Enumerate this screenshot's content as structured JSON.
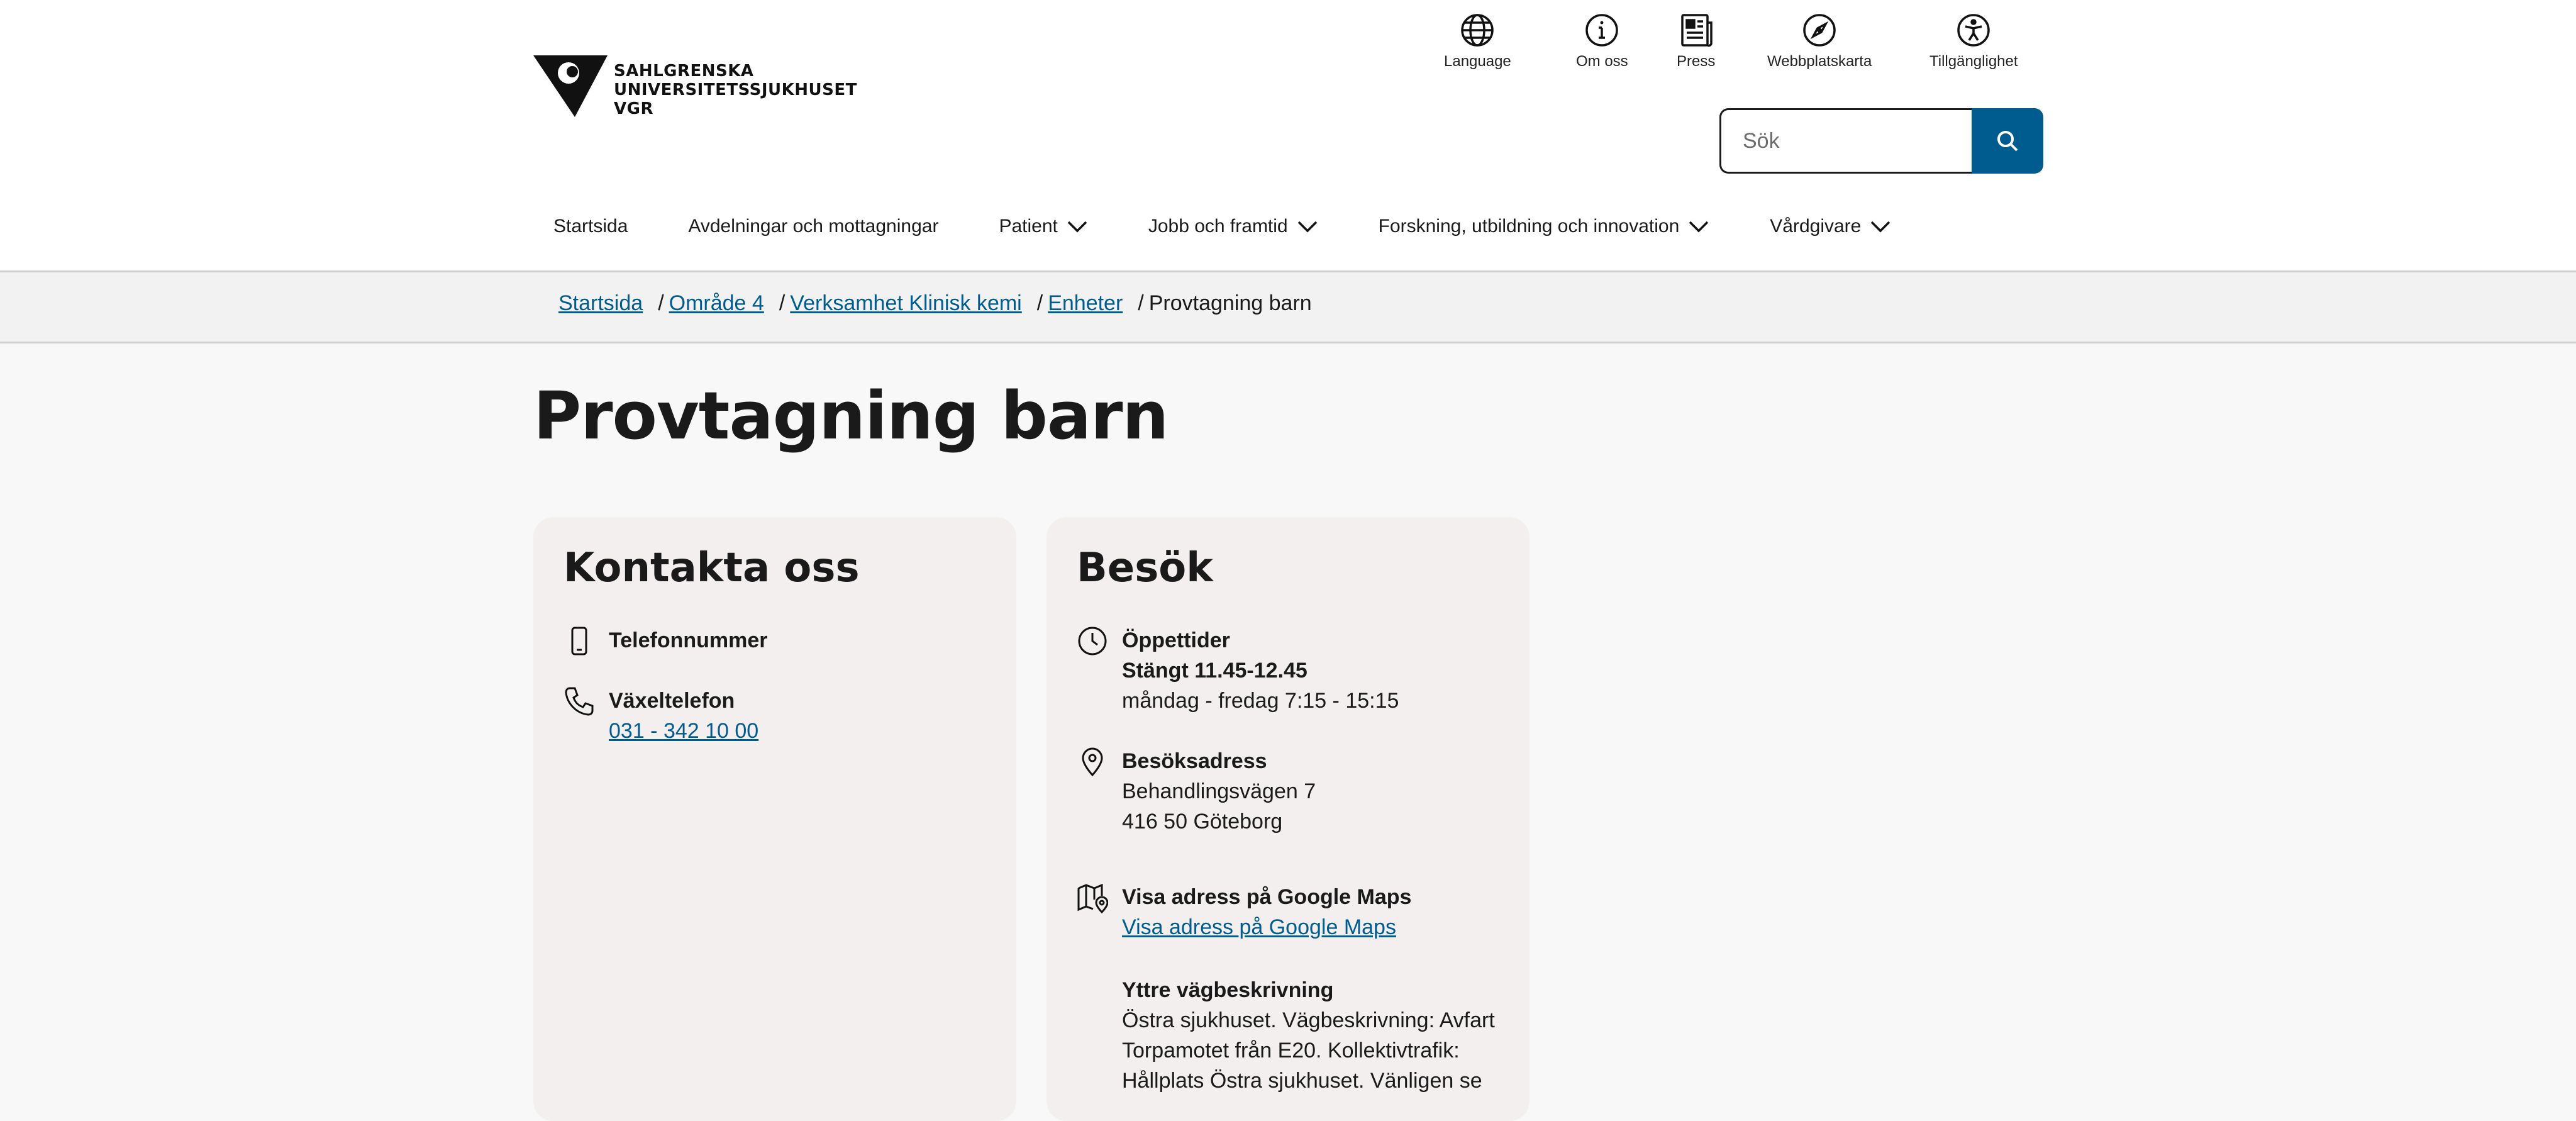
{
  "brand": {
    "line1": "SAHLGRENSKA",
    "line2": "UNIVERSITETSSJUKHUSET",
    "line3": "VGR"
  },
  "utility_nav": [
    {
      "label": "Language",
      "icon": "globe-icon"
    },
    {
      "label": "Om oss",
      "icon": "info-icon"
    },
    {
      "label": "Press",
      "icon": "newspaper-icon"
    },
    {
      "label": "Webbplatskarta",
      "icon": "compass-icon"
    },
    {
      "label": "Tillgänglighet",
      "icon": "accessibility-icon"
    }
  ],
  "search": {
    "placeholder": "Sök",
    "button_icon": "search-icon"
  },
  "main_nav": [
    {
      "label": "Startsida",
      "has_dropdown": false
    },
    {
      "label": "Avdelningar och mottagningar",
      "has_dropdown": false
    },
    {
      "label": "Patient",
      "has_dropdown": true
    },
    {
      "label": "Jobb och framtid",
      "has_dropdown": true
    },
    {
      "label": "Forskning, utbildning och innovation",
      "has_dropdown": true
    },
    {
      "label": "Vårdgivare",
      "has_dropdown": true
    }
  ],
  "breadcrumb": {
    "items": [
      "Startsida",
      "Område 4",
      "Verksamhet Klinisk kemi",
      "Enheter"
    ],
    "separator": "/",
    "current": "Provtagning barn"
  },
  "page": {
    "title": "Provtagning barn"
  },
  "contact": {
    "heading": "Kontakta oss",
    "phone_label": "Telefonnummer",
    "switchboard_label": "Växeltelefon",
    "switchboard_number": "031 - 342 10 00"
  },
  "visit": {
    "heading": "Besök",
    "hours_label": "Öppettider",
    "hours_note": "Stängt 11.45-12.45",
    "hours_value": "måndag - fredag 7:15 - 15:15",
    "address_label": "Besöksadress",
    "address_line1": "Behandlingsvägen 7",
    "address_line2": "416 50 Göteborg",
    "maps_label": "Visa adress på Google Maps",
    "maps_link": "Visa adress på Google Maps",
    "directions_label": "Yttre vägbeskrivning",
    "directions_line1": "Östra sjukhuset. Vägbeskrivning: Avfart",
    "directions_line2": "Torpamotet från E20. Kollektivtrafik:",
    "directions_line3": "Hållplats Östra sjukhuset. Vänligen se"
  },
  "colors": {
    "accent": "#005b8f",
    "card_bg": "#f2efee",
    "page_bg": "#f8f8f8",
    "header_bg": "#ffffff"
  }
}
